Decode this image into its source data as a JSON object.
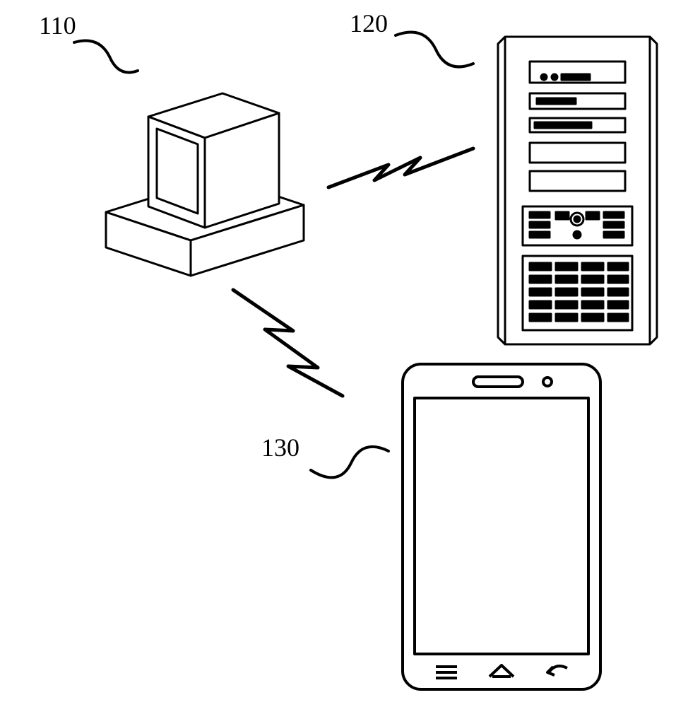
{
  "labels": {
    "computer": "110",
    "server": "120",
    "phone": "130"
  },
  "diagram": {
    "type": "system-architecture",
    "elements": [
      {
        "id": "110",
        "name": "computer-terminal",
        "depiction": "isometric desktop computer / monitor on base"
      },
      {
        "id": "120",
        "name": "server-tower",
        "depiction": "rack-style server tower with drive bays and ventilation grilles"
      },
      {
        "id": "130",
        "name": "smartphone",
        "depiction": "mobile phone with screen, menu/home/back buttons"
      }
    ],
    "connections": [
      {
        "from": "110",
        "to": "120",
        "style": "wireless-zigzag"
      },
      {
        "from": "110",
        "to": "130",
        "style": "wireless-zigzag"
      }
    ]
  }
}
